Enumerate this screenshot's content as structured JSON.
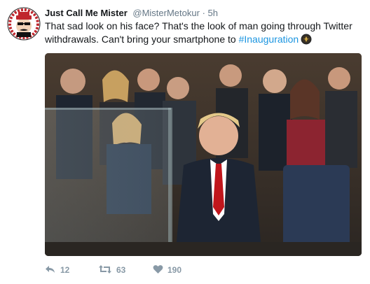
{
  "tweet": {
    "display_name": "Just Call Me Mister",
    "handle": "@MisterMetokur",
    "separator": "·",
    "time": "5h",
    "text_part1": "That sad look on his face?  That's the look of man going through Twitter withdrawals.  Can't bring your smartphone to ",
    "hashtag": "#Inauguration",
    "avatar_icon": "mister-metokur-avatar-icon",
    "emoji_icon": "inauguration-seal-icon"
  },
  "actions": {
    "reply_count": "12",
    "retweet_count": "63",
    "like_count": "190",
    "reply_icon": "reply-icon",
    "retweet_icon": "retweet-icon",
    "like_icon": "heart-icon"
  },
  "colors": {
    "text": "#14171a",
    "secondary": "#657786",
    "hashtag": "#1b95e0",
    "count": "#8899a6"
  }
}
